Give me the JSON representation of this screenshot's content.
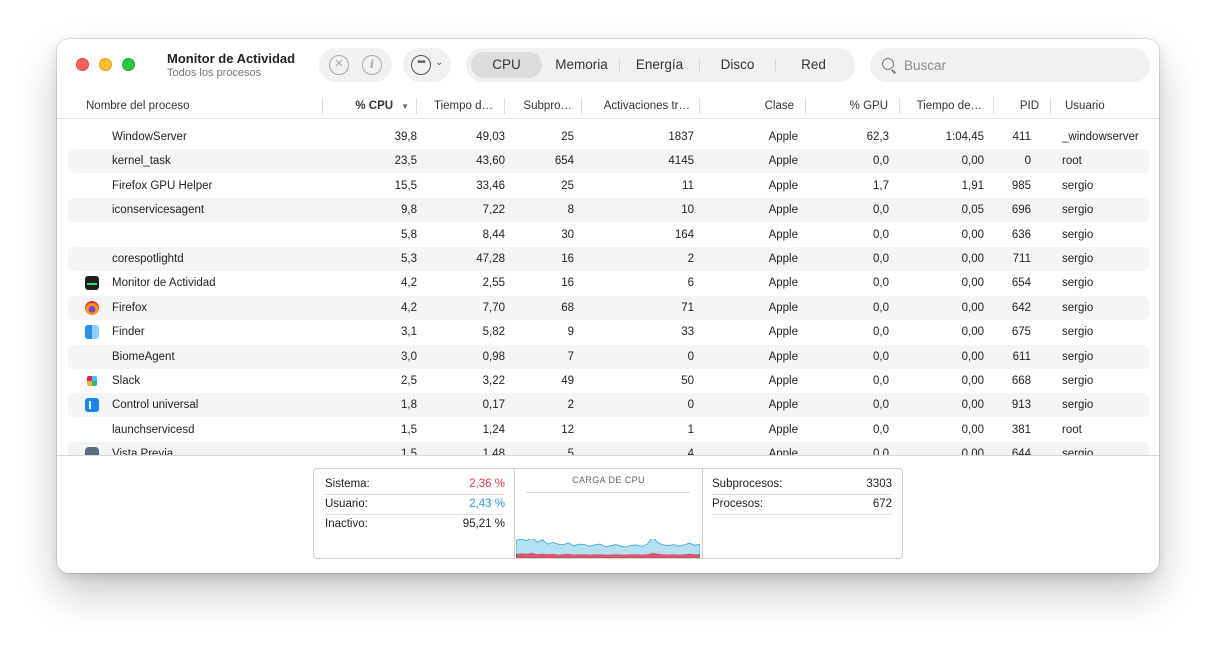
{
  "window": {
    "title": "Monitor de Actividad",
    "subtitle": "Todos los procesos"
  },
  "toolbar": {
    "stop_icon": "stop-circle-icon",
    "info_icon": "info-circle-icon",
    "more_icon": "ellipsis-circle-icon",
    "tabs": [
      {
        "label": "CPU",
        "active": true
      },
      {
        "label": "Memoria",
        "active": false
      },
      {
        "label": "Energía",
        "active": false
      },
      {
        "label": "Disco",
        "active": false
      },
      {
        "label": "Red",
        "active": false
      }
    ],
    "search_placeholder": "Buscar"
  },
  "table": {
    "headers": [
      "Nombre del proceso",
      "% CPU",
      "Tiempo d…",
      "Subpro…",
      "Activaciones tr…",
      "Clase",
      "% GPU",
      "Tiempo de…",
      "PID",
      "Usuario"
    ],
    "sorted_column": "% CPU",
    "rows": [
      {
        "name": "WindowServer",
        "icon": "",
        "cpu": "39,8",
        "time": "49,03",
        "threads": "25",
        "wakeups": "1837",
        "kind": "Apple",
        "gpu": "62,3",
        "gputime": "1:04,45",
        "pid": "411",
        "user": "_windowserver"
      },
      {
        "name": "kernel_task",
        "icon": "",
        "cpu": "23,5",
        "time": "43,60",
        "threads": "654",
        "wakeups": "4145",
        "kind": "Apple",
        "gpu": "0,0",
        "gputime": "0,00",
        "pid": "0",
        "user": "root"
      },
      {
        "name": "Firefox GPU Helper",
        "icon": "",
        "cpu": "15,5",
        "time": "33,46",
        "threads": "25",
        "wakeups": "11",
        "kind": "Apple",
        "gpu": "1,7",
        "gputime": "1,91",
        "pid": "985",
        "user": "sergio"
      },
      {
        "name": "iconservicesagent",
        "icon": "",
        "cpu": "9,8",
        "time": "7,22",
        "threads": "8",
        "wakeups": "10",
        "kind": "Apple",
        "gpu": "0,0",
        "gputime": "0,05",
        "pid": "696",
        "user": "sergio"
      },
      {
        "name": "",
        "icon": "",
        "cpu": "5,8",
        "time": "8,44",
        "threads": "30",
        "wakeups": "164",
        "kind": "Apple",
        "gpu": "0,0",
        "gputime": "0,00",
        "pid": "636",
        "user": "sergio"
      },
      {
        "name": "corespotlightd",
        "icon": "",
        "cpu": "5,3",
        "time": "47,28",
        "threads": "16",
        "wakeups": "2",
        "kind": "Apple",
        "gpu": "0,0",
        "gputime": "0,00",
        "pid": "711",
        "user": "sergio"
      },
      {
        "name": "Monitor de Actividad",
        "icon": "monitor",
        "cpu": "4,2",
        "time": "2,55",
        "threads": "16",
        "wakeups": "6",
        "kind": "Apple",
        "gpu": "0,0",
        "gputime": "0,00",
        "pid": "654",
        "user": "sergio"
      },
      {
        "name": "Firefox",
        "icon": "firefox",
        "cpu": "4,2",
        "time": "7,70",
        "threads": "68",
        "wakeups": "71",
        "kind": "Apple",
        "gpu": "0,0",
        "gputime": "0,00",
        "pid": "642",
        "user": "sergio"
      },
      {
        "name": "Finder",
        "icon": "finder",
        "cpu": "3,1",
        "time": "5,82",
        "threads": "9",
        "wakeups": "33",
        "kind": "Apple",
        "gpu": "0,0",
        "gputime": "0,00",
        "pid": "675",
        "user": "sergio"
      },
      {
        "name": "BiomeAgent",
        "icon": "",
        "cpu": "3,0",
        "time": "0,98",
        "threads": "7",
        "wakeups": "0",
        "kind": "Apple",
        "gpu": "0,0",
        "gputime": "0,00",
        "pid": "611",
        "user": "sergio"
      },
      {
        "name": "Slack",
        "icon": "slack",
        "cpu": "2,5",
        "time": "3,22",
        "threads": "49",
        "wakeups": "50",
        "kind": "Apple",
        "gpu": "0,0",
        "gputime": "0,00",
        "pid": "668",
        "user": "sergio"
      },
      {
        "name": "Control universal",
        "icon": "universal",
        "cpu": "1,8",
        "time": "0,17",
        "threads": "2",
        "wakeups": "0",
        "kind": "Apple",
        "gpu": "0,0",
        "gputime": "0,00",
        "pid": "913",
        "user": "sergio"
      },
      {
        "name": "launchservicesd",
        "icon": "",
        "cpu": "1,5",
        "time": "1,24",
        "threads": "12",
        "wakeups": "1",
        "kind": "Apple",
        "gpu": "0,0",
        "gputime": "0,00",
        "pid": "381",
        "user": "root"
      },
      {
        "name": "Vista Previa",
        "icon": "preview",
        "cpu": "1,5",
        "time": "1,48",
        "threads": "5",
        "wakeups": "4",
        "kind": "Apple",
        "gpu": "0,0",
        "gputime": "0,00",
        "pid": "644",
        "user": "sergio"
      }
    ]
  },
  "footer": {
    "sistema_label": "Sistema:",
    "sistema_value": "2,36 %",
    "usuario_label": "Usuario:",
    "usuario_value": "2,43 %",
    "inactivo_label": "Inactivo:",
    "inactivo_value": "95,21 %",
    "chart_title": "CARGA DE CPU",
    "subprocesos_label": "Subprocesos:",
    "subprocesos_value": "3303",
    "procesos_label": "Procesos:",
    "procesos_value": "672",
    "colors": {
      "sistema": "#e0364c",
      "usuario": "#2aa2d9"
    },
    "cpu_load_history": {
      "usuario": [
        3.2,
        3.4,
        3.1,
        3.6,
        2.9,
        3.3,
        2.4,
        2.7,
        2.5,
        2.2,
        2.6,
        2.1,
        2.4,
        2.3,
        2.0,
        2.2,
        2.4,
        1.9,
        2.1,
        2.3,
        2.0,
        1.8,
        2.1,
        2.2,
        1.9,
        2.4,
        3.8,
        2.6,
        2.2,
        2.1,
        2.3,
        2.0,
        2.2,
        2.5,
        2.1,
        2.4
      ],
      "sistema": [
        1.0,
        1.1,
        1.0,
        1.2,
        0.9,
        1.0,
        0.9,
        1.0,
        0.8,
        0.9,
        1.0,
        0.8,
        0.9,
        0.9,
        0.8,
        0.9,
        0.9,
        0.8,
        0.8,
        0.9,
        0.8,
        0.8,
        0.9,
        0.9,
        0.8,
        0.9,
        1.2,
        1.0,
        0.9,
        0.8,
        0.9,
        0.8,
        0.9,
        1.0,
        0.9,
        0.9
      ]
    }
  }
}
